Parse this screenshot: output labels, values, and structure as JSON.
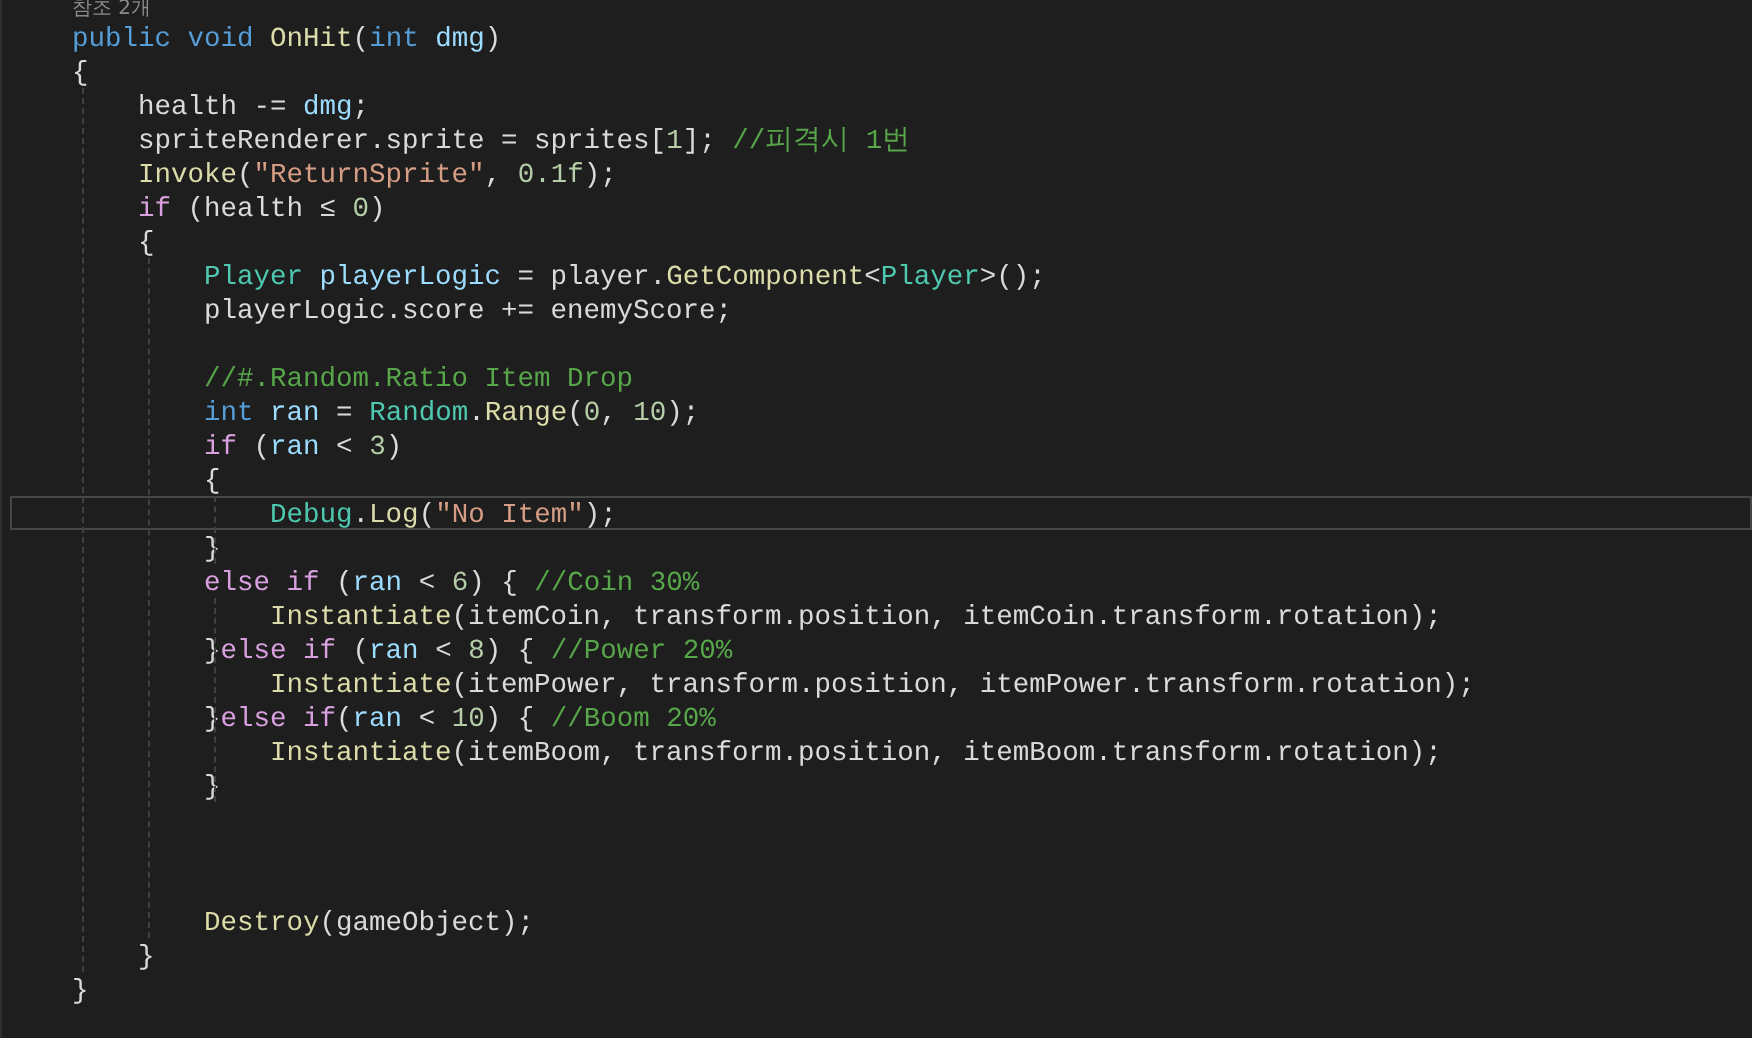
{
  "codelens": "참조 2개",
  "code_lines": [
    {
      "kind": "code",
      "current": false,
      "tokens": [
        {
          "kind": "keyword",
          "text": "public "
        },
        {
          "kind": "keyword",
          "text": "void "
        },
        {
          "kind": "method",
          "text": "OnHit"
        },
        {
          "kind": "plain",
          "text": "("
        },
        {
          "kind": "keyword",
          "text": "int "
        },
        {
          "kind": "local",
          "text": "dmg"
        },
        {
          "kind": "plain",
          "text": ")"
        }
      ]
    },
    {
      "kind": "code",
      "current": false,
      "tokens": [
        {
          "kind": "plain",
          "text": "{"
        }
      ]
    },
    {
      "kind": "code",
      "current": false,
      "tokens": [
        {
          "kind": "plain",
          "text": "    health -= "
        },
        {
          "kind": "local",
          "text": "dmg"
        },
        {
          "kind": "plain",
          "text": ";"
        }
      ]
    },
    {
      "kind": "code",
      "current": false,
      "tokens": [
        {
          "kind": "plain",
          "text": "    spriteRenderer.sprite = sprites["
        },
        {
          "kind": "number",
          "text": "1"
        },
        {
          "kind": "plain",
          "text": "]; "
        },
        {
          "kind": "comment",
          "text": "//피격시 1번"
        }
      ]
    },
    {
      "kind": "code",
      "current": false,
      "tokens": [
        {
          "kind": "method",
          "text": "    Invoke"
        },
        {
          "kind": "plain",
          "text": "("
        },
        {
          "kind": "string",
          "text": "\"ReturnSprite\""
        },
        {
          "kind": "plain",
          "text": ", "
        },
        {
          "kind": "number",
          "text": "0.1f"
        },
        {
          "kind": "plain",
          "text": ");"
        }
      ]
    },
    {
      "kind": "code",
      "current": false,
      "tokens": [
        {
          "kind": "control",
          "text": "    if"
        },
        {
          "kind": "plain",
          "text": " (health ≤ "
        },
        {
          "kind": "number",
          "text": "0"
        },
        {
          "kind": "plain",
          "text": ")"
        }
      ]
    },
    {
      "kind": "code",
      "current": false,
      "tokens": [
        {
          "kind": "plain",
          "text": "    {"
        }
      ]
    },
    {
      "kind": "code",
      "current": false,
      "tokens": [
        {
          "kind": "type",
          "text": "        Player "
        },
        {
          "kind": "local",
          "text": "playerLogic"
        },
        {
          "kind": "plain",
          "text": " = player."
        },
        {
          "kind": "method",
          "text": "GetComponent"
        },
        {
          "kind": "plain",
          "text": "<"
        },
        {
          "kind": "type",
          "text": "Player"
        },
        {
          "kind": "plain",
          "text": ">();"
        }
      ]
    },
    {
      "kind": "code",
      "current": false,
      "tokens": [
        {
          "kind": "plain",
          "text": "        playerLogic.score += enemyScore;"
        }
      ]
    },
    {
      "kind": "blank"
    },
    {
      "kind": "code",
      "current": false,
      "tokens": [
        {
          "kind": "comment",
          "text": "        //#.Random.Ratio Item Drop"
        }
      ]
    },
    {
      "kind": "code",
      "current": false,
      "tokens": [
        {
          "kind": "keyword",
          "text": "        int "
        },
        {
          "kind": "local",
          "text": "ran"
        },
        {
          "kind": "plain",
          "text": " = "
        },
        {
          "kind": "type",
          "text": "Random"
        },
        {
          "kind": "plain",
          "text": "."
        },
        {
          "kind": "method",
          "text": "Range"
        },
        {
          "kind": "plain",
          "text": "("
        },
        {
          "kind": "number",
          "text": "0"
        },
        {
          "kind": "plain",
          "text": ", "
        },
        {
          "kind": "number",
          "text": "10"
        },
        {
          "kind": "plain",
          "text": ");"
        }
      ]
    },
    {
      "kind": "code",
      "current": false,
      "tokens": [
        {
          "kind": "control",
          "text": "        if"
        },
        {
          "kind": "plain",
          "text": " ("
        },
        {
          "kind": "local",
          "text": "ran"
        },
        {
          "kind": "plain",
          "text": " < "
        },
        {
          "kind": "number",
          "text": "3"
        },
        {
          "kind": "plain",
          "text": ")"
        }
      ]
    },
    {
      "kind": "code",
      "current": false,
      "tokens": [
        {
          "kind": "plain",
          "text": "        {"
        }
      ]
    },
    {
      "kind": "code",
      "current": true,
      "tokens": [
        {
          "kind": "type",
          "text": "            Debug"
        },
        {
          "kind": "plain",
          "text": "."
        },
        {
          "kind": "method",
          "text": "Log"
        },
        {
          "kind": "plain",
          "text": "("
        },
        {
          "kind": "string",
          "text": "\"No Item\""
        },
        {
          "kind": "plain",
          "text": ");"
        }
      ]
    },
    {
      "kind": "code",
      "current": false,
      "tokens": [
        {
          "kind": "plain",
          "text": "        }"
        }
      ]
    },
    {
      "kind": "code",
      "current": false,
      "tokens": [
        {
          "kind": "control",
          "text": "        else if"
        },
        {
          "kind": "plain",
          "text": " ("
        },
        {
          "kind": "local",
          "text": "ran"
        },
        {
          "kind": "plain",
          "text": " < "
        },
        {
          "kind": "number",
          "text": "6"
        },
        {
          "kind": "plain",
          "text": ") { "
        },
        {
          "kind": "comment",
          "text": "//Coin 30%"
        }
      ]
    },
    {
      "kind": "code",
      "current": false,
      "tokens": [
        {
          "kind": "method",
          "text": "            Instantiate"
        },
        {
          "kind": "plain",
          "text": "(itemCoin, transform.position, itemCoin.transform.rotation);"
        }
      ]
    },
    {
      "kind": "code",
      "current": false,
      "tokens": [
        {
          "kind": "plain",
          "text": "        }"
        },
        {
          "kind": "control",
          "text": "else if"
        },
        {
          "kind": "plain",
          "text": " ("
        },
        {
          "kind": "local",
          "text": "ran"
        },
        {
          "kind": "plain",
          "text": " < "
        },
        {
          "kind": "number",
          "text": "8"
        },
        {
          "kind": "plain",
          "text": ") { "
        },
        {
          "kind": "comment",
          "text": "//Power 20%"
        }
      ]
    },
    {
      "kind": "code",
      "current": false,
      "tokens": [
        {
          "kind": "method",
          "text": "            Instantiate"
        },
        {
          "kind": "plain",
          "text": "(itemPower, transform.position, itemPower.transform.rotation);"
        }
      ]
    },
    {
      "kind": "code",
      "current": false,
      "tokens": [
        {
          "kind": "plain",
          "text": "        }"
        },
        {
          "kind": "control",
          "text": "else if"
        },
        {
          "kind": "plain",
          "text": "("
        },
        {
          "kind": "local",
          "text": "ran"
        },
        {
          "kind": "plain",
          "text": " < "
        },
        {
          "kind": "number",
          "text": "10"
        },
        {
          "kind": "plain",
          "text": ") { "
        },
        {
          "kind": "comment",
          "text": "//Boom 20%"
        }
      ]
    },
    {
      "kind": "code",
      "current": false,
      "tokens": [
        {
          "kind": "method",
          "text": "            Instantiate"
        },
        {
          "kind": "plain",
          "text": "(itemBoom, transform.position, itemBoom.transform.rotation);"
        }
      ]
    },
    {
      "kind": "code",
      "current": false,
      "tokens": [
        {
          "kind": "plain",
          "text": "        }"
        }
      ]
    },
    {
      "kind": "blank"
    },
    {
      "kind": "blank"
    },
    {
      "kind": "blank"
    },
    {
      "kind": "code",
      "current": false,
      "tokens": [
        {
          "kind": "method",
          "text": "        Destroy"
        },
        {
          "kind": "plain",
          "text": "(gameObject);"
        }
      ]
    },
    {
      "kind": "code",
      "current": false,
      "tokens": [
        {
          "kind": "plain",
          "text": "    }"
        }
      ]
    },
    {
      "kind": "code",
      "current": false,
      "tokens": [
        {
          "kind": "plain",
          "text": "}"
        }
      ]
    }
  ]
}
